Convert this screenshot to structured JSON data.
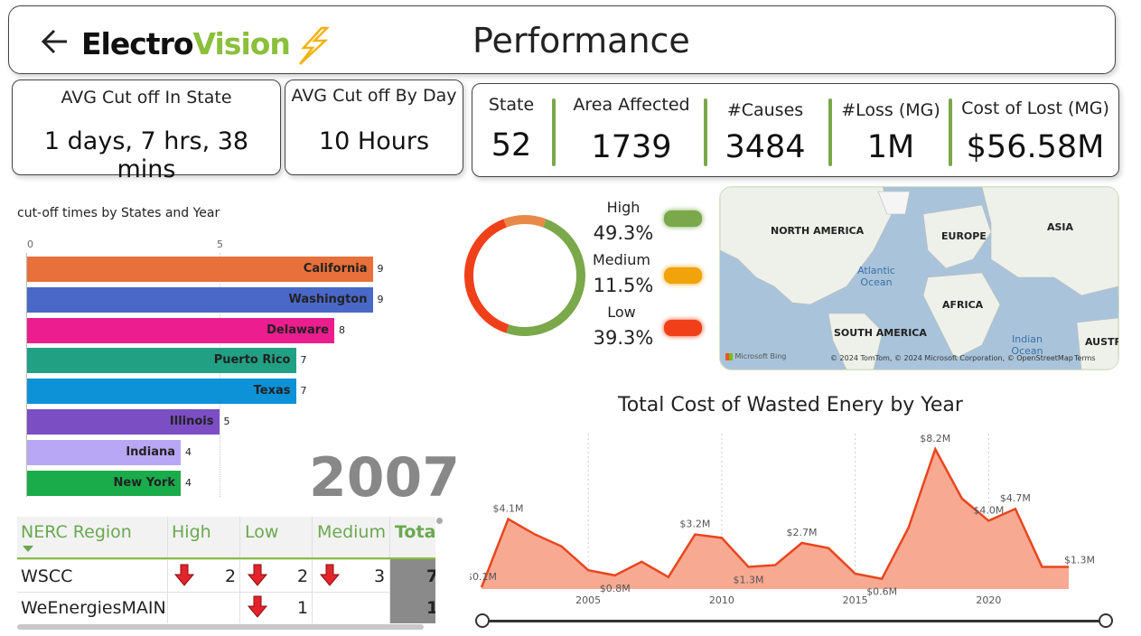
{
  "header": {
    "title": "Performance",
    "logo_word1": "Electro",
    "logo_word2": "Vision"
  },
  "kpi_state": {
    "label": "AVG Cut off In State",
    "value": "1 days, 7 hrs, 38 mins"
  },
  "kpi_day": {
    "label": "AVG Cut off By Day",
    "value": "10 Hours"
  },
  "stats": [
    {
      "label": "State",
      "value": "52"
    },
    {
      "label": "Area Affected",
      "value": "1739"
    },
    {
      "label": "#Causes",
      "value": "3484"
    },
    {
      "label": "#Loss (MG)",
      "value": "1M"
    },
    {
      "label": "Cost of Lost (MG)",
      "value": "$56.58M"
    }
  ],
  "bar_chart": {
    "title": "cut-off times by States and Year",
    "ticks": [
      "0",
      "5"
    ],
    "year": "2007",
    "states": [
      {
        "name": "California",
        "value": 9,
        "label": "9",
        "color": "#e8703a"
      },
      {
        "name": "Washington",
        "value": 9,
        "label": "9",
        "color": "#4968c8"
      },
      {
        "name": "Delaware",
        "value": 8,
        "label": "8",
        "color": "#ec1d8f"
      },
      {
        "name": "Puerto Rico",
        "value": 7,
        "label": "7",
        "color": "#22a083"
      },
      {
        "name": "Texas",
        "value": 7,
        "label": "7",
        "color": "#0d92d8"
      },
      {
        "name": "Illinois",
        "value": 5,
        "label": "5",
        "color": "#7b4ec4"
      },
      {
        "name": "Indiana",
        "value": 4,
        "label": "4",
        "color": "#b8a7f5"
      },
      {
        "name": "New York",
        "value": 4,
        "label": "4",
        "color": "#1aab4b"
      }
    ]
  },
  "matrix": {
    "headers": [
      "NERC Region",
      "High",
      "Low",
      "Medium",
      "Total"
    ],
    "rows": [
      {
        "region": "WSCC",
        "high": "2",
        "low": "2",
        "medium": "3",
        "total": "7"
      },
      {
        "region": "WeEnergiesMAIN",
        "high": "",
        "low": "1",
        "medium": "",
        "total": "1"
      }
    ]
  },
  "donut": {
    "items": [
      {
        "label": "High",
        "pct": "49.3%",
        "value": 49.3,
        "color": "#7aa84a"
      },
      {
        "label": "Medium",
        "pct": "11.5%",
        "value": 11.5,
        "color": "#e8894a"
      },
      {
        "label": "Low",
        "pct": "39.3%",
        "value": 39.3,
        "color": "#f0401a"
      }
    ],
    "pill_colors": [
      "#7aa84a",
      "#f0a30a",
      "#f0401a"
    ]
  },
  "map": {
    "labels": [
      "NORTH AMERICA",
      "EUROPE",
      "ASIA",
      "AFRICA",
      "SOUTH AMERICA",
      "AUSTR"
    ],
    "seas": [
      "Atlantic Ocean",
      "Indian Ocean"
    ],
    "brand": "Microsoft Bing",
    "credits": "© 2024 TomTom, © 2024 Microsoft Corporation, © OpenStreetMap",
    "terms": "Terms"
  },
  "chart_data": {
    "type": "area",
    "title": "Total Cost of Wasted Enery by Year",
    "xlabel": "",
    "ylabel": "",
    "x_ticks": [
      "2005",
      "2010",
      "2015",
      "2020"
    ],
    "x": [
      2001,
      2002,
      2003,
      2004,
      2005,
      2006,
      2007,
      2008,
      2009,
      2010,
      2011,
      2012,
      2013,
      2014,
      2015,
      2016,
      2017,
      2018,
      2019,
      2020,
      2021,
      2022,
      2023
    ],
    "values": [
      0.1,
      4.1,
      3.2,
      2.5,
      1.1,
      0.8,
      1.6,
      0.7,
      3.2,
      3.0,
      1.3,
      1.4,
      2.7,
      2.4,
      0.9,
      0.6,
      3.6,
      8.2,
      5.3,
      4.0,
      4.7,
      1.3,
      1.3
    ],
    "data_labels": [
      {
        "x": 2001,
        "text": "$0.1M"
      },
      {
        "x": 2002,
        "text": "$4.1M"
      },
      {
        "x": 2006,
        "text": "$0.8M"
      },
      {
        "x": 2009,
        "text": "$3.2M"
      },
      {
        "x": 2011,
        "text": "$1.3M"
      },
      {
        "x": 2013,
        "text": "$2.7M"
      },
      {
        "x": 2016,
        "text": "$0.6M"
      },
      {
        "x": 2018,
        "text": "$8.2M"
      },
      {
        "x": 2020,
        "text": "$4.0M"
      },
      {
        "x": 2021,
        "text": "$4.7M"
      },
      {
        "x": 2023,
        "text": "$1.3M"
      }
    ],
    "ylim": [
      0,
      9
    ],
    "area_color": "#f8a992",
    "line_color": "#e8461f"
  }
}
